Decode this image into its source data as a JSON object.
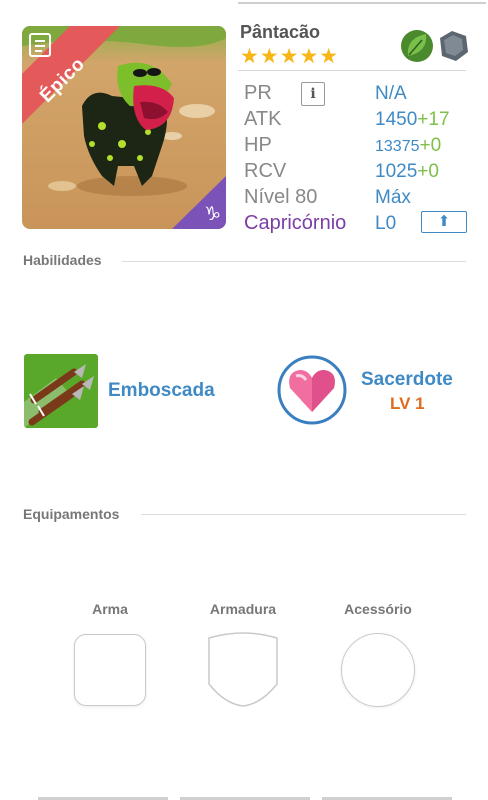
{
  "monster": {
    "name": "Pântacão",
    "rarity": "Épico",
    "stars": "★★★★★",
    "element_icons": [
      "leaf-element-icon",
      "rock-element-icon"
    ]
  },
  "stats": {
    "pr_label": "PR",
    "pr_value": "N/A",
    "info_icon": "i",
    "atk_label": "ATK",
    "atk_value": "1450",
    "atk_bonus": "+17",
    "hp_label": "HP",
    "hp_value": "13375",
    "hp_bonus": "+0",
    "rcv_label": "RCV",
    "rcv_value": "1025",
    "rcv_bonus": "+0",
    "level_label": "Nível 80",
    "level_value": "Máx",
    "zodiac_label": "Capricórnio",
    "zodiac_value": "L0",
    "upgrade_icon": "⬆"
  },
  "abilities": {
    "title": "Habilidades",
    "skill_name": "Emboscada",
    "leader_name": "Sacerdote",
    "leader_level": "LV 1"
  },
  "equipment": {
    "title": "Equipamentos",
    "weapon_label": "Arma",
    "armor_label": "Armadura",
    "accessory_label": "Acessório"
  },
  "colors": {
    "accent_blue": "#3f8ac4",
    "bonus_green": "#7dc04a",
    "zodiac_purple": "#7b3ea6",
    "level_orange": "#e06c1e",
    "star_gold": "#f7b614",
    "rarity_red": "#e45a5a"
  }
}
